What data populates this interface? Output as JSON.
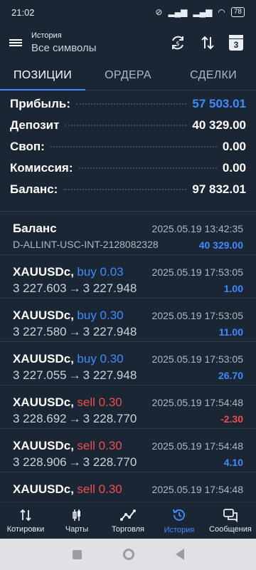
{
  "status": {
    "time": "21:02",
    "battery": "78"
  },
  "header": {
    "title": "История",
    "subtitle": "Все символы"
  },
  "calendar_day": "3",
  "tabs": [
    {
      "label": "ПОЗИЦИИ",
      "active": true
    },
    {
      "label": "ОРДЕРА",
      "active": false
    },
    {
      "label": "СДЕЛКИ",
      "active": false
    }
  ],
  "summary": [
    {
      "label": "Прибыль:",
      "value": "57 503.01",
      "color": "#3d8bff"
    },
    {
      "label": "Депозит",
      "value": "40 329.00"
    },
    {
      "label": "Своп:",
      "value": "0.00"
    },
    {
      "label": "Комиссия:",
      "value": "0.00"
    },
    {
      "label": "Баланс:",
      "value": "97 832.01"
    }
  ],
  "balance_entry": {
    "title": "Баланс",
    "comment": "D-ALLINT-USC-INT-2128082328",
    "time": "2025.05.19 13:42:35",
    "amount": "40 329.00"
  },
  "deals": [
    {
      "symbol": "XAUUSDc,",
      "side": "buy 0.03",
      "open": "3 227.603",
      "arrow": "→",
      "close": "3 227.948",
      "time": "2025.05.19 17:53:05",
      "profit": "1.00"
    },
    {
      "symbol": "XAUUSDc,",
      "side": "buy 0.30",
      "open": "3 227.580",
      "arrow": "→",
      "close": "3 227.948",
      "time": "2025.05.19 17:53:05",
      "profit": "11.00"
    },
    {
      "symbol": "XAUUSDc,",
      "side": "buy 0.30",
      "open": "3 227.055",
      "arrow": "→",
      "close": "3 227.948",
      "time": "2025.05.19 17:53:05",
      "profit": "26.70"
    },
    {
      "symbol": "XAUUSDc,",
      "side": "sell 0.30",
      "open": "3 228.692",
      "arrow": "→",
      "close": "3 228.770",
      "time": "2025.05.19 17:54:48",
      "profit": "-2.30"
    },
    {
      "symbol": "XAUUSDc,",
      "side": "sell 0.30",
      "open": "3 228.906",
      "arrow": "→",
      "close": "3 228.770",
      "time": "2025.05.19 17:54:48",
      "profit": "4.10"
    },
    {
      "symbol": "XAUUSDc,",
      "side": "sell 0.30",
      "time": "2025.05.19 17:54:48"
    }
  ],
  "bottom_nav": [
    {
      "label": "Котировки",
      "icon": "sort-arrows-icon"
    },
    {
      "label": "Чарты",
      "icon": "candlestick-icon"
    },
    {
      "label": "Торговля",
      "icon": "trend-line-icon"
    },
    {
      "label": "История",
      "icon": "history-clock-icon",
      "active": true
    },
    {
      "label": "Сообщения",
      "icon": "chat-bubbles-icon"
    }
  ],
  "colors": {
    "accent": "#3d8bff",
    "negative": "#ee4d4d",
    "background": "#1b2634"
  }
}
